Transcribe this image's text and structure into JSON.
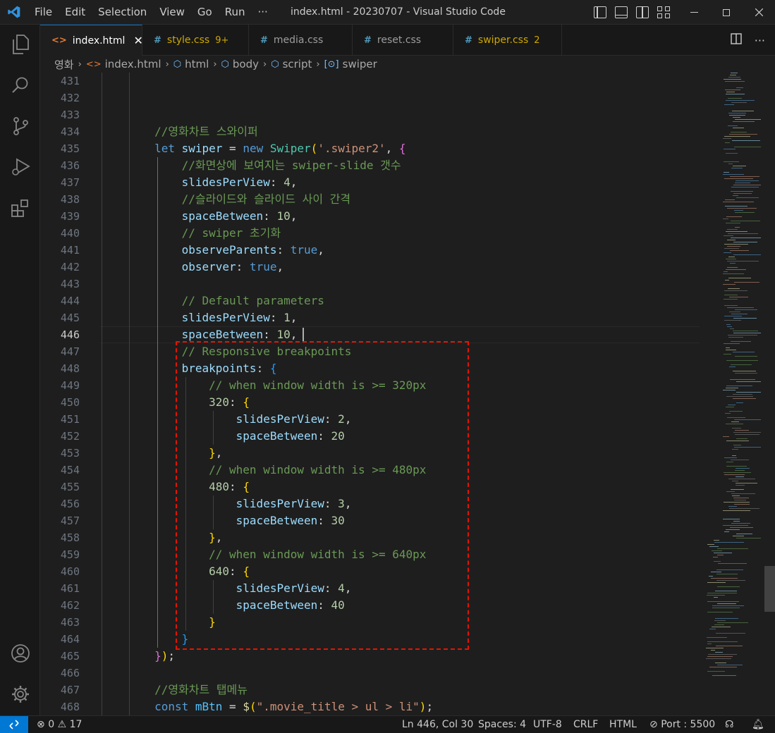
{
  "window": {
    "title": "index.html - 20230707 - Visual Studio Code",
    "menu": [
      "File",
      "Edit",
      "Selection",
      "View",
      "Go",
      "Run",
      "···"
    ]
  },
  "tabs": [
    {
      "label": "index.html",
      "icon": "html-icon",
      "active": true
    },
    {
      "label": "style.css",
      "icon": "css-icon",
      "badge": "9+"
    },
    {
      "label": "media.css",
      "icon": "css-icon"
    },
    {
      "label": "reset.css",
      "icon": "css-icon"
    },
    {
      "label": "swiper.css",
      "icon": "css-icon",
      "badge": "2"
    }
  ],
  "breadcrumb": [
    "영화",
    "index.html",
    "html",
    "body",
    "script",
    "swiper"
  ],
  "editor": {
    "current_line": 446,
    "line_numbers": [
      "431",
      "432",
      "433",
      "434",
      "435",
      "436",
      "437",
      "438",
      "439",
      "440",
      "441",
      "442",
      "443",
      "444",
      "445",
      "446",
      "447",
      "448",
      "449",
      "450",
      "451",
      "452",
      "453",
      "454",
      "455",
      "456",
      "457",
      "458",
      "459",
      "460",
      "461",
      "462",
      "463",
      "464",
      "465",
      "466",
      "467",
      "468"
    ]
  },
  "statusbar": {
    "problems_errors": "0",
    "problems_warnings": "17",
    "position": "Ln 446, Col 30",
    "spaces": "Spaces: 4",
    "encoding": "UTF-8",
    "eol": "CRLF",
    "language": "HTML",
    "port": "Port : 5500"
  },
  "colors": {
    "accent": "#0078d4",
    "highlight_box": "#e51400",
    "warning": "#cca700"
  }
}
